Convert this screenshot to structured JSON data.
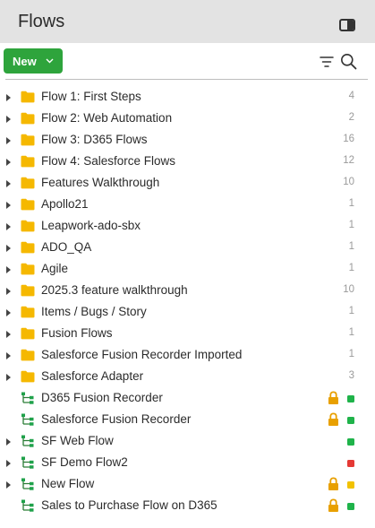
{
  "header": {
    "title": "Flows",
    "panel_toggle_icon": "panel-toggle-icon"
  },
  "toolbar": {
    "new_label": "New",
    "new_dropdown_icon": "chevron-down-icon",
    "filter_icon": "filter-icon",
    "search_icon": "search-icon"
  },
  "colors": {
    "accent_green": "#2ea43c",
    "folder": "#f5b800",
    "lock": "#e8a000",
    "status_green": "#1fb34a",
    "status_red": "#e53935",
    "status_yellow": "#f2c200"
  },
  "items": [
    {
      "type": "folder",
      "label": "Flow 1: First Steps",
      "count": "4",
      "expandable": true
    },
    {
      "type": "folder",
      "label": "Flow 2: Web Automation",
      "count": "2",
      "expandable": true
    },
    {
      "type": "folder",
      "label": "Flow 3: D365 Flows",
      "count": "16",
      "expandable": true
    },
    {
      "type": "folder",
      "label": "Flow 4: Salesforce Flows",
      "count": "12",
      "expandable": true
    },
    {
      "type": "folder",
      "label": "Features Walkthrough",
      "count": "10",
      "expandable": true
    },
    {
      "type": "folder",
      "label": "Apollo21",
      "count": "1",
      "expandable": true
    },
    {
      "type": "folder",
      "label": "Leapwork-ado-sbx",
      "count": "1",
      "expandable": true
    },
    {
      "type": "folder",
      "label": "ADO_QA",
      "count": "1",
      "expandable": true
    },
    {
      "type": "folder",
      "label": "Agile",
      "count": "1",
      "expandable": true
    },
    {
      "type": "folder",
      "label": "2025.3 feature walkthrough",
      "count": "10",
      "expandable": true
    },
    {
      "type": "folder",
      "label": "Items / Bugs / Story",
      "count": "1",
      "expandable": true
    },
    {
      "type": "folder",
      "label": "Fusion Flows",
      "count": "1",
      "expandable": true
    },
    {
      "type": "folder",
      "label": "Salesforce Fusion Recorder Imported",
      "count": "1",
      "expandable": true
    },
    {
      "type": "folder",
      "label": "Salesforce Adapter",
      "count": "3",
      "expandable": true
    },
    {
      "type": "flow",
      "label": "D365 Fusion Recorder",
      "expandable": false,
      "locked": true,
      "status": "green"
    },
    {
      "type": "flow",
      "label": "Salesforce Fusion Recorder",
      "expandable": false,
      "locked": true,
      "status": "green"
    },
    {
      "type": "flow",
      "label": "SF Web Flow",
      "expandable": true,
      "locked": false,
      "status": "green"
    },
    {
      "type": "flow",
      "label": "SF Demo Flow2",
      "expandable": true,
      "locked": false,
      "status": "red"
    },
    {
      "type": "flow",
      "label": "New Flow",
      "expandable": true,
      "locked": true,
      "status": "yellow"
    },
    {
      "type": "flow",
      "label": "Sales to Purchase Flow on D365",
      "expandable": false,
      "locked": true,
      "status": "green"
    }
  ]
}
